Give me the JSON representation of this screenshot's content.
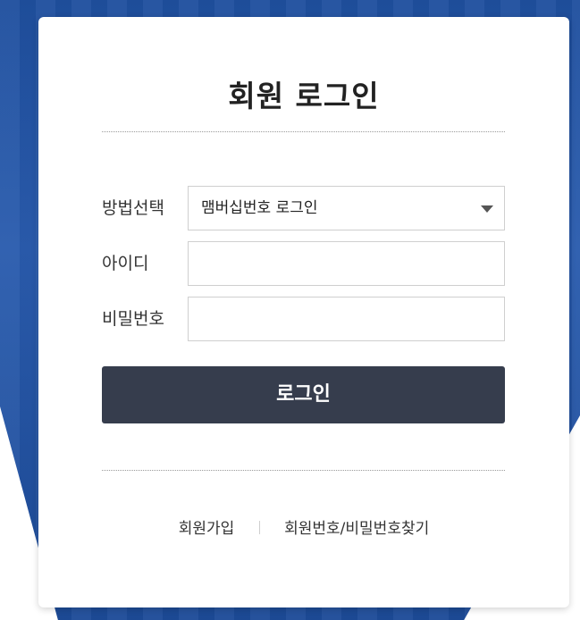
{
  "title": "회원 로그인",
  "form": {
    "method_label": "방법선택",
    "method_value": "맴버십번호 로그인",
    "id_label": "아이디",
    "id_value": "",
    "password_label": "비밀번호",
    "password_value": ""
  },
  "login_button": "로그인",
  "footer_links": {
    "signup": "회원가입",
    "find": "회원번호/비밀번호찾기"
  },
  "colors": {
    "background_blue": "#1f4f9e",
    "button_dark": "#363d4d"
  }
}
